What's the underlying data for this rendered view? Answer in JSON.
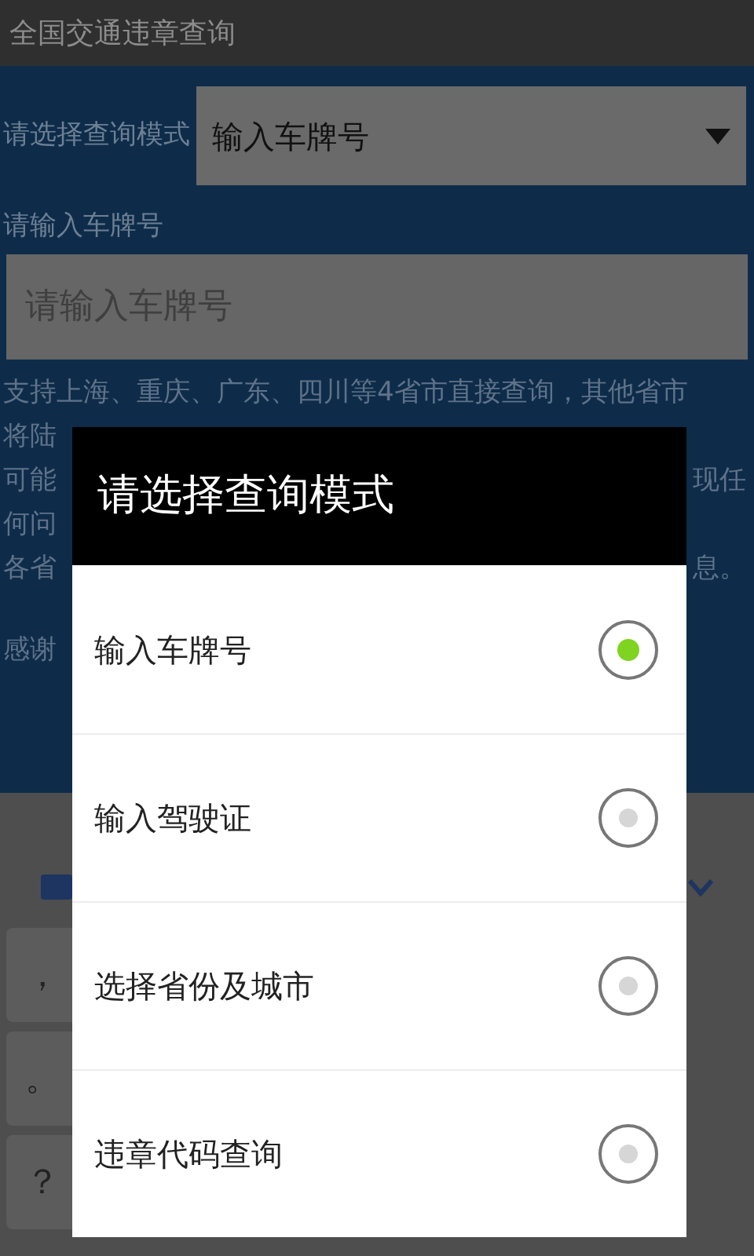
{
  "app_bar": {
    "title": "全国交通违章查询"
  },
  "mode_label": "请选择查询模式",
  "mode_select": {
    "value": "输入车牌号"
  },
  "plate_label": "请输入车牌号",
  "plate_field": {
    "placeholder": "请输入车牌号"
  },
  "notice_lines": [
    {
      "left": "支持上海、重庆、广东、四川等4省市直接查询，其他省市"
    },
    {
      "left": "将陆"
    },
    {
      "left": "可能",
      "right": "现任"
    },
    {
      "left": "何问"
    },
    {
      "left": "各省",
      "right": "息。"
    },
    {
      "left": "感谢"
    }
  ],
  "keyboard": {
    "keys": [
      {
        "label": "，"
      },
      {
        "label": "。"
      },
      {
        "label": "？"
      }
    ]
  },
  "dialog": {
    "title": "请选择查询模式",
    "options": [
      {
        "label": "输入车牌号",
        "selected": true
      },
      {
        "label": "输入驾驶证",
        "selected": false
      },
      {
        "label": "选择省份及城市",
        "selected": false
      },
      {
        "label": "违章代码查询",
        "selected": false
      }
    ]
  }
}
